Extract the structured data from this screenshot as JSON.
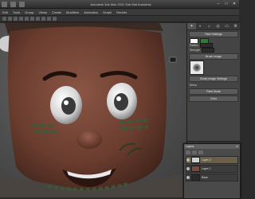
{
  "titlebar": {
    "app_title": "Autodesk 3ds Max 2011   Sub Mat   Autodesk",
    "minimize": "–",
    "maximize": "□",
    "close": "✕"
  },
  "menubar": {
    "items": [
      "Edit",
      "Tools",
      "Group",
      "Views",
      "Create",
      "Modifiers",
      "Animation",
      "Graph",
      "Render"
    ]
  },
  "toolbar": {
    "icons": [
      "undo-icon",
      "redo-icon",
      "select-icon",
      "move-icon",
      "rotate-icon",
      "scale-icon",
      "snap-icon",
      "mirror-icon",
      "align-icon",
      "render-icon"
    ]
  },
  "command_panel": {
    "tabs": [
      "✦",
      "◐",
      "⌂",
      "◎",
      "▭",
      "⚙"
    ],
    "rollouts": [
      "Paint Settings",
      "Brush Image",
      "Brush Image Settings",
      "Paint Mode",
      "Color"
    ],
    "rows": [
      "Radius",
      "Strength",
      "Mirror"
    ],
    "fg_color": "#ffffff",
    "bg_color": "#2e7d32"
  },
  "layer_panel": {
    "title": "Layers",
    "close": "✕",
    "layers": [
      {
        "name": "Layer 2",
        "selected": true
      },
      {
        "name": "Layer 1",
        "selected": false
      },
      {
        "name": "Base",
        "selected": false
      }
    ]
  },
  "colors": {
    "skin": "#7a4a3a",
    "skin_shadow": "#4b2a20",
    "face_paint": "#3c5a3a"
  }
}
